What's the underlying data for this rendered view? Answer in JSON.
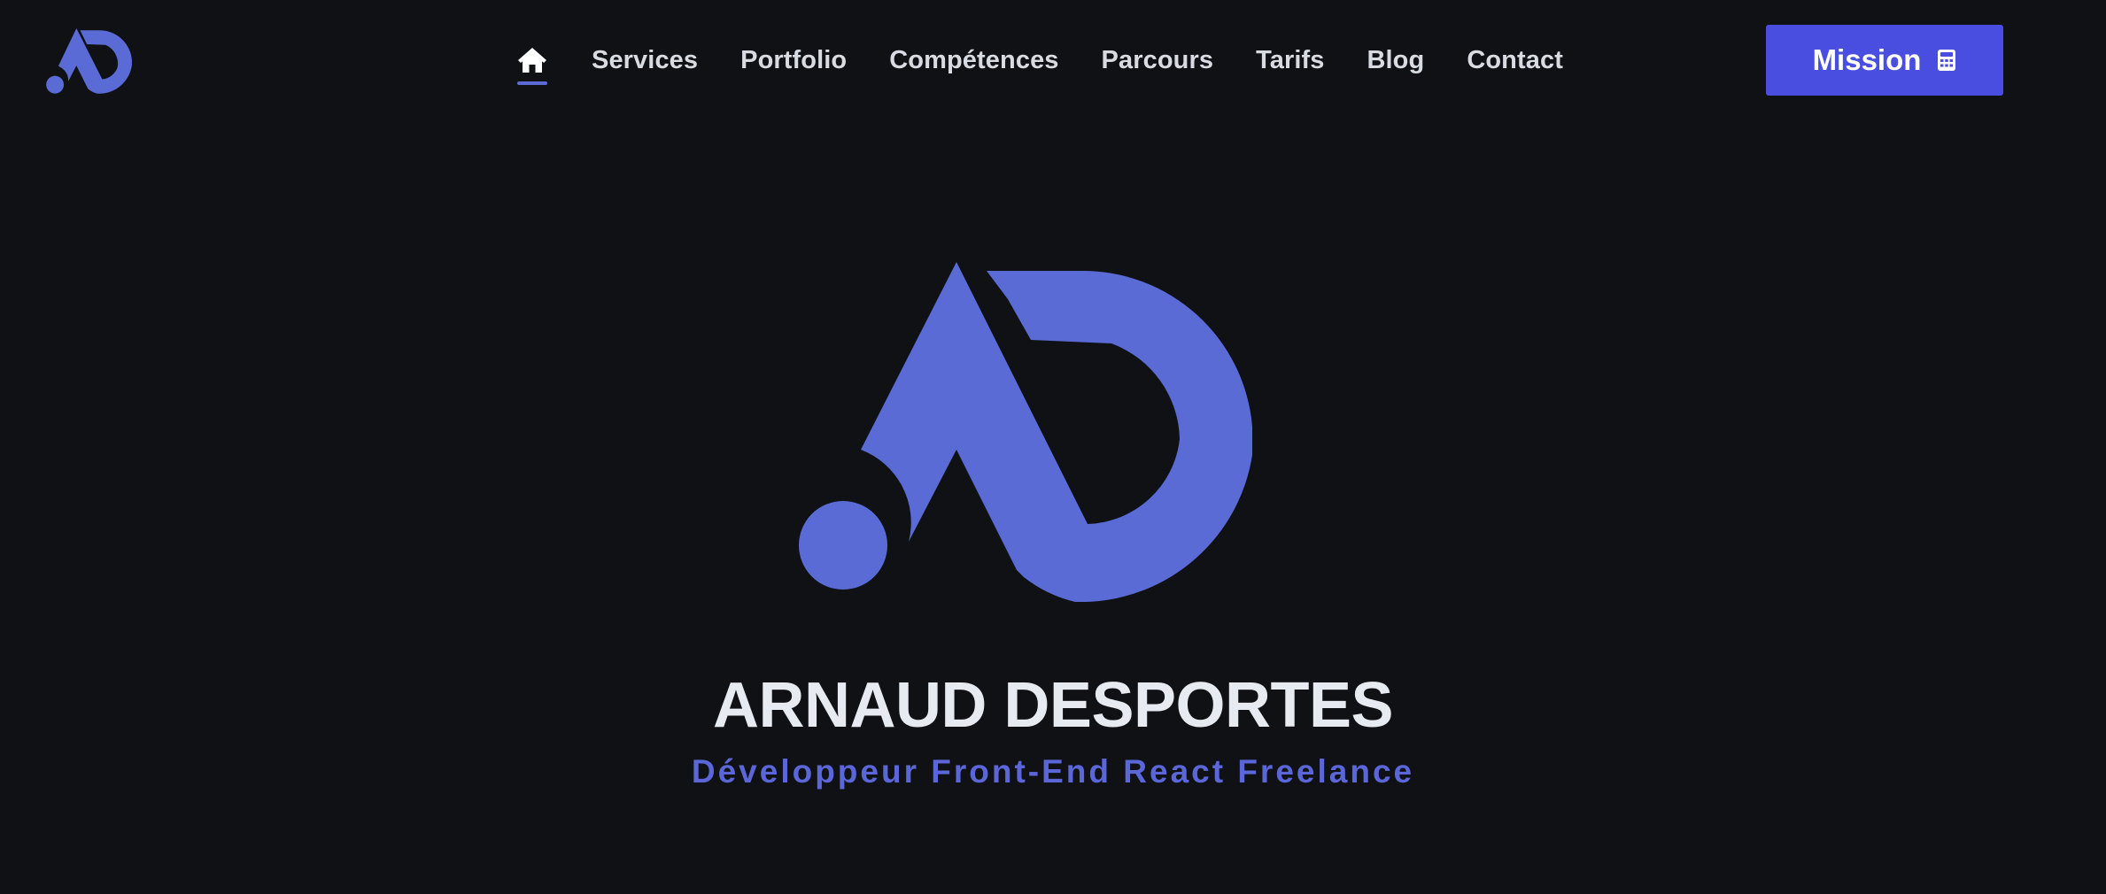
{
  "brand": {
    "logo_icon": "ad-monogram-logo",
    "accent_color": "#5b6bd6"
  },
  "nav": {
    "home_icon": "home-icon",
    "items": [
      {
        "label": "Services"
      },
      {
        "label": "Portfolio"
      },
      {
        "label": "Compétences"
      },
      {
        "label": "Parcours"
      },
      {
        "label": "Tarifs"
      },
      {
        "label": "Blog"
      },
      {
        "label": "Contact"
      }
    ]
  },
  "cta": {
    "label": "Mission",
    "icon": "calculator-icon",
    "color": "#4a4ee0"
  },
  "hero": {
    "name": "ARNAUD DESPORTES",
    "tagline": "Développeur Front-End React Freelance",
    "tagline_color": "#5b67d8"
  },
  "colors": {
    "background": "#0f1115",
    "nav_text": "#d9dbe3",
    "name_text": "#e8eaf1"
  }
}
